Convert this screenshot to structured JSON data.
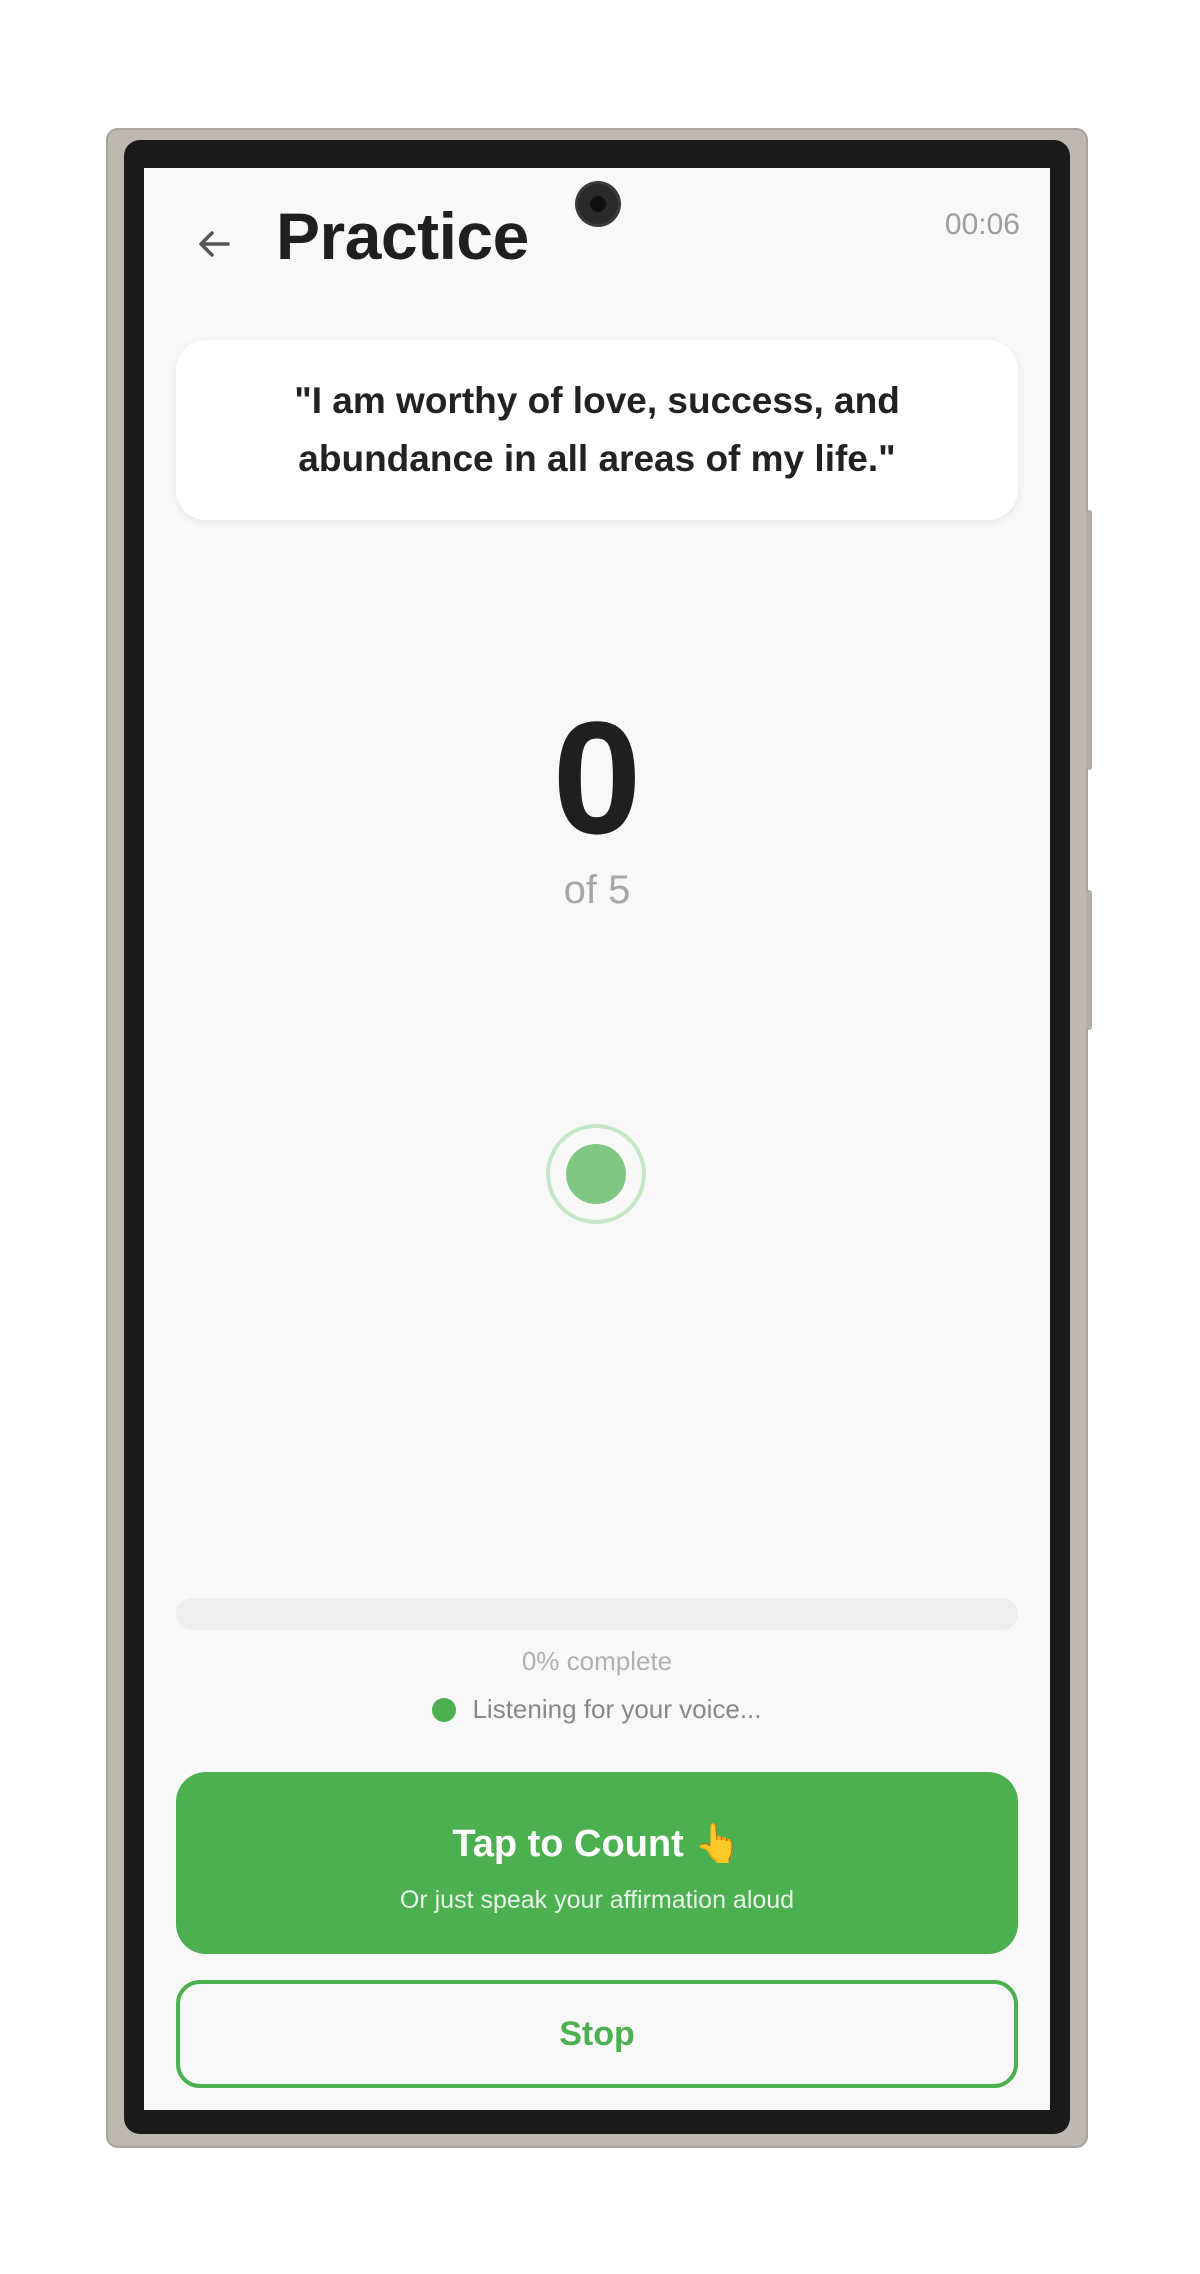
{
  "header": {
    "back_icon": "arrow-left-icon",
    "title": "Practice",
    "timer": "00:06"
  },
  "affirmation": {
    "text": "\"I am worthy of love, success, and abundance in all areas of my life.\""
  },
  "counter": {
    "count": "0",
    "of_label": "of 5"
  },
  "mic_indicator": {
    "icon": "voice-indicator-icon",
    "color": "#81c784"
  },
  "progress": {
    "value": 0,
    "label": "0% complete"
  },
  "status": {
    "text": "Listening for your voice...",
    "dot_color": "#4caf50"
  },
  "tap_button": {
    "label": "Tap to Count 👆",
    "sublabel": "Or just speak your affirmation aloud",
    "color": "#4caf50"
  },
  "stop_button": {
    "label": "Stop"
  },
  "colors": {
    "accent": "#4caf50",
    "background": "#f8f8f8",
    "text_primary": "#1f1f1f",
    "text_muted": "#a6a6a6"
  }
}
